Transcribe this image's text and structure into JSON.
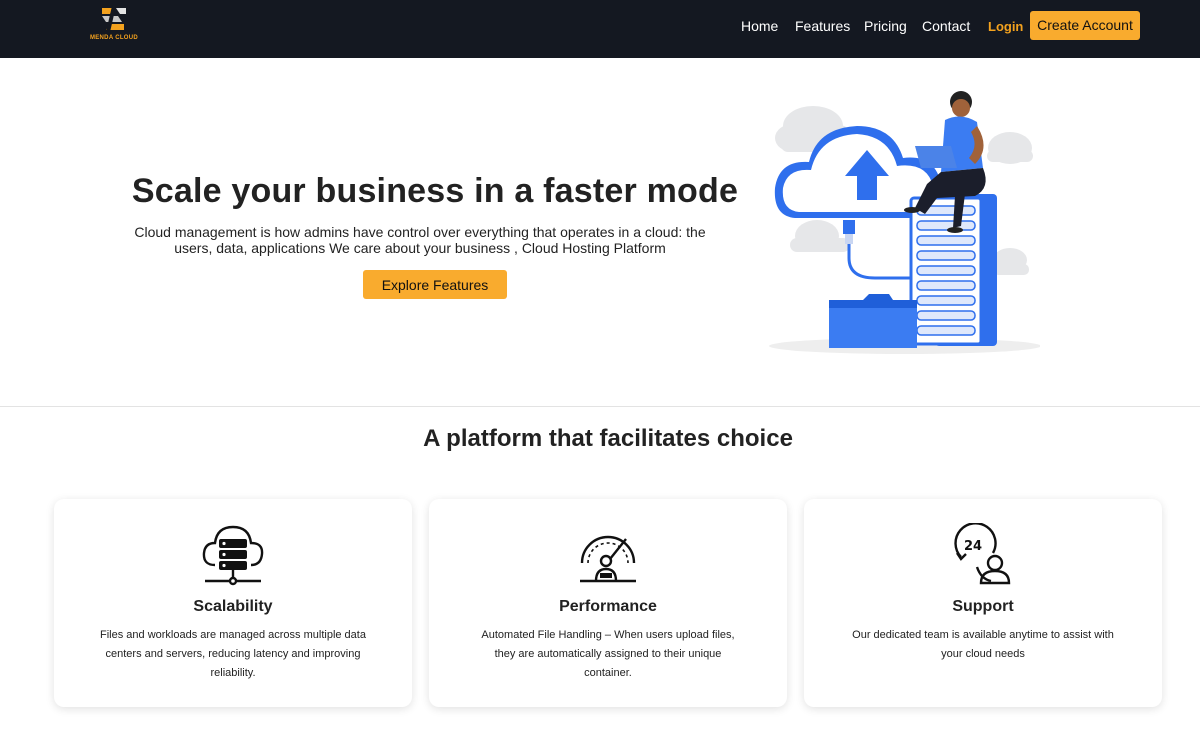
{
  "brand": {
    "name": "MENDA CLOUD",
    "logo_icon": "s-logo-icon",
    "accent": "#f4a21e"
  },
  "nav": {
    "links": [
      "Home",
      "Features",
      "Pricing",
      "Contact"
    ],
    "login": "Login",
    "cta": "Create Account"
  },
  "hero": {
    "title": "Scale your business in a faster mode",
    "subtitle_line1": "Cloud management is how admins have control over everything that operates in a cloud: the",
    "subtitle_line2": "users, data, applications We care about your business , Cloud Hosting Platform",
    "button": "Explore Features",
    "illustration": "cloud-upload-server-illustration"
  },
  "section": {
    "title": "A platform that facilitates choice"
  },
  "features": [
    {
      "icon": "cloud-server-icon",
      "title": "Scalability",
      "text": "Files and workloads are managed across multiple data centers and servers, reducing latency and improving reliability."
    },
    {
      "icon": "speedometer-icon",
      "title": "Performance",
      "text": "Automated File Handling – When users upload files, they are automatically assigned to their unique container."
    },
    {
      "icon": "support-24-icon",
      "title": "Support",
      "text": "Our dedicated team is available anytime to assist with your cloud needs"
    }
  ],
  "colors": {
    "nav_bg": "#141821",
    "button": "#f9ab2e",
    "illustration_blue": "#2f6fed"
  }
}
